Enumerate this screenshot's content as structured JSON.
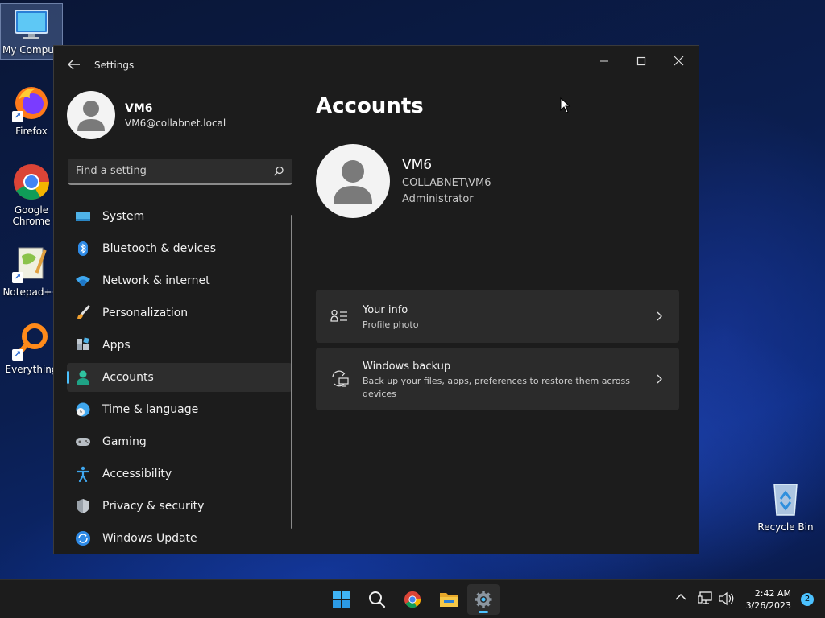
{
  "desktop": {
    "icons": [
      {
        "label": "My Computer",
        "icon": "monitor-icon"
      },
      {
        "label": "Firefox",
        "icon": "firefox-icon"
      },
      {
        "label": "Google Chrome",
        "icon": "chrome-icon"
      },
      {
        "label": "Notepad++",
        "icon": "notepadpp-icon"
      },
      {
        "label": "Everything",
        "icon": "everything-icon"
      },
      {
        "label": "Recycle Bin",
        "icon": "recycle-bin-icon"
      }
    ]
  },
  "window": {
    "title": "Settings",
    "controls": [
      "minimize",
      "maximize",
      "close"
    ]
  },
  "profile": {
    "name": "VM6",
    "email": "VM6@collabnet.local"
  },
  "search": {
    "placeholder": "Find a setting"
  },
  "nav": {
    "items": [
      {
        "label": "System",
        "icon": "system-icon"
      },
      {
        "label": "Bluetooth & devices",
        "icon": "bluetooth-icon"
      },
      {
        "label": "Network & internet",
        "icon": "wifi-icon"
      },
      {
        "label": "Personalization",
        "icon": "brush-icon"
      },
      {
        "label": "Apps",
        "icon": "apps-icon"
      },
      {
        "label": "Accounts",
        "icon": "person-icon",
        "active": true
      },
      {
        "label": "Time & language",
        "icon": "globe-clock-icon"
      },
      {
        "label": "Gaming",
        "icon": "gamepad-icon"
      },
      {
        "label": "Accessibility",
        "icon": "accessibility-icon"
      },
      {
        "label": "Privacy & security",
        "icon": "shield-icon"
      },
      {
        "label": "Windows Update",
        "icon": "update-icon"
      }
    ]
  },
  "content": {
    "title": "Accounts",
    "user": {
      "name": "VM6",
      "domain": "COLLABNET\\VM6",
      "role": "Administrator"
    },
    "cards": [
      {
        "title": "Your info",
        "subtitle": "Profile photo",
        "icon": "person-details-icon"
      },
      {
        "title": "Windows backup",
        "subtitle": "Back up your files, apps, preferences to restore them across devices",
        "icon": "backup-sync-icon"
      }
    ]
  },
  "taskbar": {
    "apps": [
      "start-icon",
      "search-icon",
      "chrome-icon",
      "file-explorer-icon",
      "settings-gear-icon"
    ],
    "clock": {
      "time": "2:42 AM",
      "date": "3/26/2023"
    },
    "notifications": "2"
  },
  "colors": {
    "accent": "#4cc2ff",
    "window_bg": "#1c1c1c",
    "card_bg": "#2b2b2b"
  }
}
